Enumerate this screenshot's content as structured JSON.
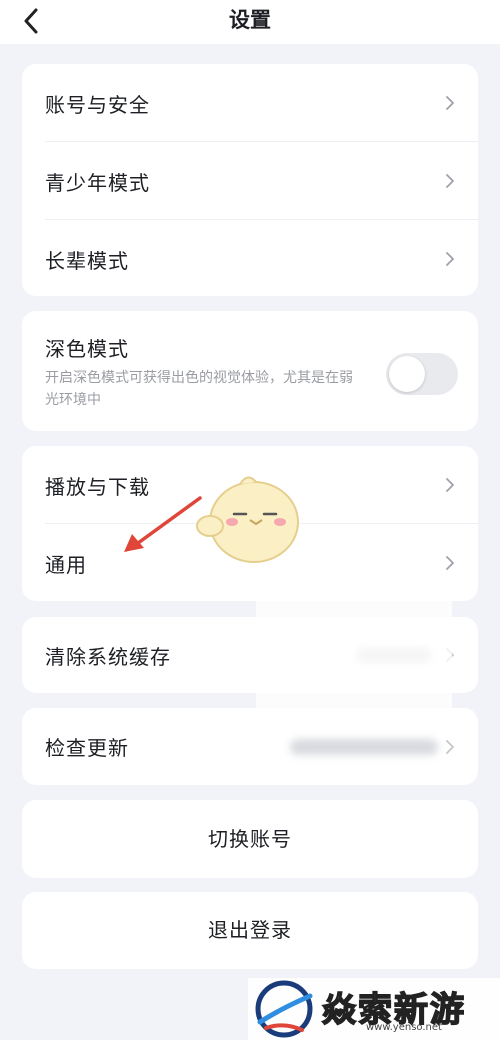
{
  "header": {
    "title": "设置",
    "back_icon": "chevron-left-icon"
  },
  "account_group": {
    "items": [
      {
        "label": "账号与安全",
        "icon": "chevron-right-icon"
      },
      {
        "label": "青少年模式",
        "icon": "chevron-right-icon"
      },
      {
        "label": "长辈模式",
        "icon": "chevron-right-icon"
      }
    ]
  },
  "dark_mode": {
    "title": "深色模式",
    "description": "开启深色模式可获得出色的视觉体验，尤其是在弱光环境中",
    "enabled": false
  },
  "media_group": {
    "items": [
      {
        "label": "播放与下载",
        "icon": "chevron-right-icon"
      },
      {
        "label": "通用",
        "icon": "chevron-right-icon"
      }
    ]
  },
  "cache": {
    "label": "清除系统缓存"
  },
  "update": {
    "label": "检查更新"
  },
  "switch_account": {
    "label": "切换账号"
  },
  "logout": {
    "label": "退出登录"
  },
  "watermark": {
    "text": "焱索新游网",
    "url": "www.yenso.net"
  },
  "colors": {
    "background": "#f1f3f8",
    "card": "#ffffff",
    "arrow": "#e0453a",
    "toggle_off": "#e9eaee"
  }
}
